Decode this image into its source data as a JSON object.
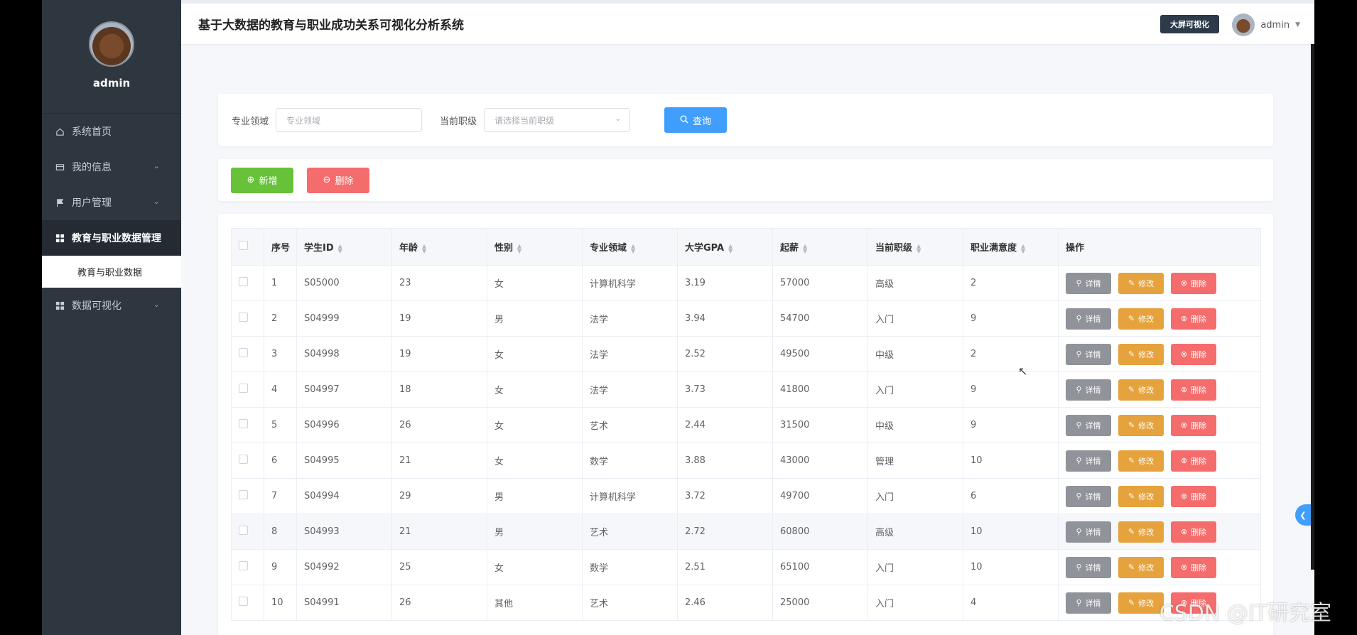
{
  "app": {
    "title": "基于大数据的教育与职业成功关系可视化分析系统",
    "bigscreen_label": "大屏可视化",
    "user": "admin"
  },
  "sidebar": {
    "username": "admin",
    "items": [
      {
        "label": "系统首页",
        "icon": "home-icon"
      },
      {
        "label": "我的信息",
        "icon": "card-icon"
      },
      {
        "label": "用户管理",
        "icon": "flag-icon"
      },
      {
        "label": "教育与职业数据管理",
        "icon": "grid-icon"
      },
      {
        "label": "数据可视化",
        "icon": "grid-icon"
      }
    ],
    "submenu": {
      "label": "教育与职业数据"
    }
  },
  "search": {
    "major_label": "专业领域",
    "major_placeholder": "专业领域",
    "level_label": "当前职级",
    "level_placeholder": "请选择当前职级",
    "query_label": "查询"
  },
  "actions": {
    "add_label": "新增",
    "delete_label": "删除"
  },
  "table": {
    "headers": [
      "序号",
      "学生ID",
      "年龄",
      "性别",
      "专业领域",
      "大学GPA",
      "起薪",
      "当前职级",
      "职业满意度",
      "操作"
    ],
    "op_labels": {
      "detail": "详情",
      "edit": "修改",
      "remove": "删除"
    },
    "rows": [
      [
        "1",
        "S05000",
        "23",
        "女",
        "计算机科学",
        "3.19",
        "57000",
        "高级",
        "2"
      ],
      [
        "2",
        "S04999",
        "19",
        "男",
        "法学",
        "3.94",
        "54700",
        "入门",
        "9"
      ],
      [
        "3",
        "S04998",
        "19",
        "女",
        "法学",
        "2.52",
        "49500",
        "中级",
        "2"
      ],
      [
        "4",
        "S04997",
        "18",
        "女",
        "法学",
        "3.73",
        "41800",
        "入门",
        "9"
      ],
      [
        "5",
        "S04996",
        "26",
        "女",
        "艺术",
        "2.44",
        "31500",
        "中级",
        "9"
      ],
      [
        "6",
        "S04995",
        "21",
        "女",
        "数学",
        "3.88",
        "43000",
        "管理",
        "10"
      ],
      [
        "7",
        "S04994",
        "29",
        "男",
        "计算机科学",
        "3.72",
        "49700",
        "入门",
        "6"
      ],
      [
        "8",
        "S04993",
        "21",
        "男",
        "艺术",
        "2.72",
        "60800",
        "高级",
        "10"
      ],
      [
        "9",
        "S04992",
        "25",
        "女",
        "数学",
        "2.51",
        "65100",
        "入门",
        "10"
      ],
      [
        "10",
        "S04991",
        "26",
        "其他",
        "艺术",
        "2.46",
        "25000",
        "入门",
        "4"
      ]
    ]
  },
  "watermark": "CSDN @IT研究室"
}
